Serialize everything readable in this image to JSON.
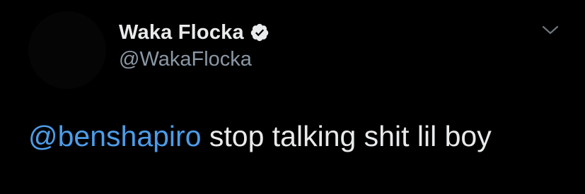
{
  "tweet": {
    "author": {
      "display_name": "Waka Flocka",
      "handle": "@WakaFlocka",
      "verified": true
    },
    "icons": {
      "verified": "verified-badge-icon",
      "menu": "chevron-down-icon"
    },
    "body": {
      "mention": "@benshapiro",
      "text": " stop talking shit lil boy"
    },
    "colors": {
      "background": "#000000",
      "primary_text": "#e8eaec",
      "secondary_text": "#8b98a5",
      "link": "#4d9ce8"
    }
  }
}
